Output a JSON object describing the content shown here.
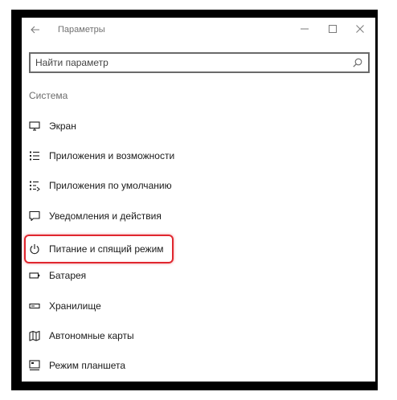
{
  "window": {
    "title": "Параметры",
    "back_icon": "back-arrow-icon",
    "controls": [
      "minimize-icon",
      "maximize-icon",
      "close-icon"
    ]
  },
  "search": {
    "placeholder": "Найти параметр",
    "value": "",
    "icon": "search-icon"
  },
  "section": {
    "title": "Система"
  },
  "menu": {
    "items": [
      {
        "label": "Экран",
        "icon": "display-icon"
      },
      {
        "label": "Приложения и возможности",
        "icon": "apps-list-icon"
      },
      {
        "label": "Приложения по умолчанию",
        "icon": "default-apps-icon"
      },
      {
        "label": "Уведомления и действия",
        "icon": "notifications-icon"
      },
      {
        "label": "Питание и спящий режим",
        "icon": "power-icon",
        "highlighted": true
      },
      {
        "label": "Батарея",
        "icon": "battery-icon"
      },
      {
        "label": "Хранилище",
        "icon": "storage-icon"
      },
      {
        "label": "Автономные карты",
        "icon": "map-icon"
      },
      {
        "label": "Режим планшета",
        "icon": "tablet-mode-icon"
      }
    ]
  },
  "colors": {
    "highlight_border": "#e0272f",
    "text": "#1a1a1a",
    "muted": "#6d6d6d"
  }
}
